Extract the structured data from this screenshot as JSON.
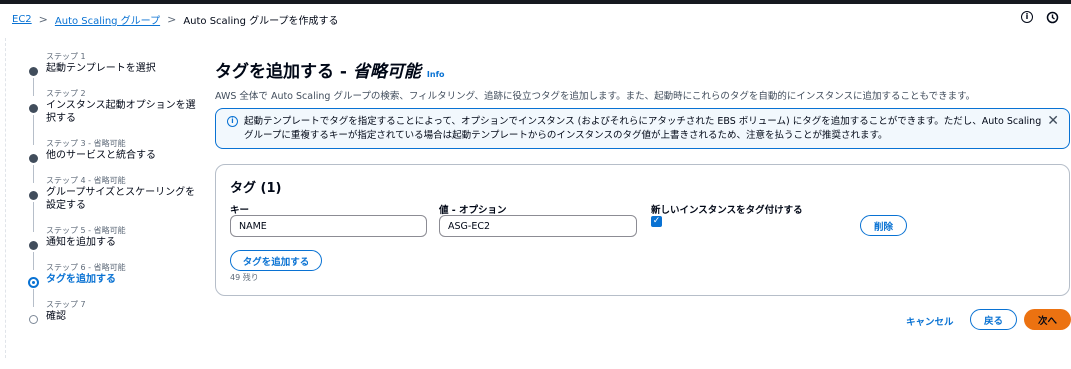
{
  "breadcrumb": {
    "items": [
      {
        "label": "EC2"
      },
      {
        "label": "Auto Scaling グループ"
      },
      {
        "label": "Auto Scaling グループを作成する"
      }
    ],
    "separator": ">"
  },
  "top_icons": [
    {
      "icon": "info-circle-icon",
      "glyph": "i"
    },
    {
      "icon": "clock-icon"
    }
  ],
  "steps": [
    {
      "sub": "ステップ 1",
      "title": "起動テンプレートを選択"
    },
    {
      "sub": "ステップ 2",
      "title": "インスタンス起動オプションを選択する"
    },
    {
      "sub": "ステップ 3 - 省略可能",
      "title": "他のサービスと統合する"
    },
    {
      "sub": "ステップ 4 - 省略可能",
      "title": "グループサイズとスケーリングを設定する"
    },
    {
      "sub": "ステップ 5 - 省略可能",
      "title": "通知を追加する"
    },
    {
      "sub": "ステップ 6 - 省略可能",
      "title": "タグを追加する"
    },
    {
      "sub": "ステップ 7",
      "title": "確認"
    }
  ],
  "page": {
    "title": "タグを追加する - ",
    "title_optional": "省略可能",
    "info": "Info",
    "description": "AWS 全体で Auto Scaling グループの検索、フィルタリング、追跡に役立つタグを追加します。また、起動時にこれらのタグを自動的にインスタンスに追加することもできます。"
  },
  "alert": {
    "icon": "info-circle-icon",
    "text": "起動テンプレートでタグを指定することによって、オプションでインスタンス (およびそれらにアタッチされた EBS ボリューム) にタグを追加することができます。ただし、Auto Scaling グループに重複するキーが指定されている場合は起動テンプレートからのインスタンスのタグ値が上書きされるため、注意を払うことが推奨されます。",
    "close": "✕"
  },
  "tags_panel": {
    "title": "タグ (1)",
    "key_label": "キー",
    "value_label": "値 - オプション",
    "propagate_label": "新しいインスタンスをタグ付けする",
    "rows": [
      {
        "key": "NAME",
        "value": "ASG-EC2",
        "propagate": true
      }
    ],
    "remove_label": "削除",
    "add_label": "タグを追加する",
    "remaining": "49 残り"
  },
  "footer": {
    "cancel": "キャンセル",
    "back": "戻る",
    "next": "次へ"
  },
  "colors": {
    "accent": "#0972d3",
    "primary_button": "#ec7211",
    "alert_bg": "#f2f8fd"
  }
}
